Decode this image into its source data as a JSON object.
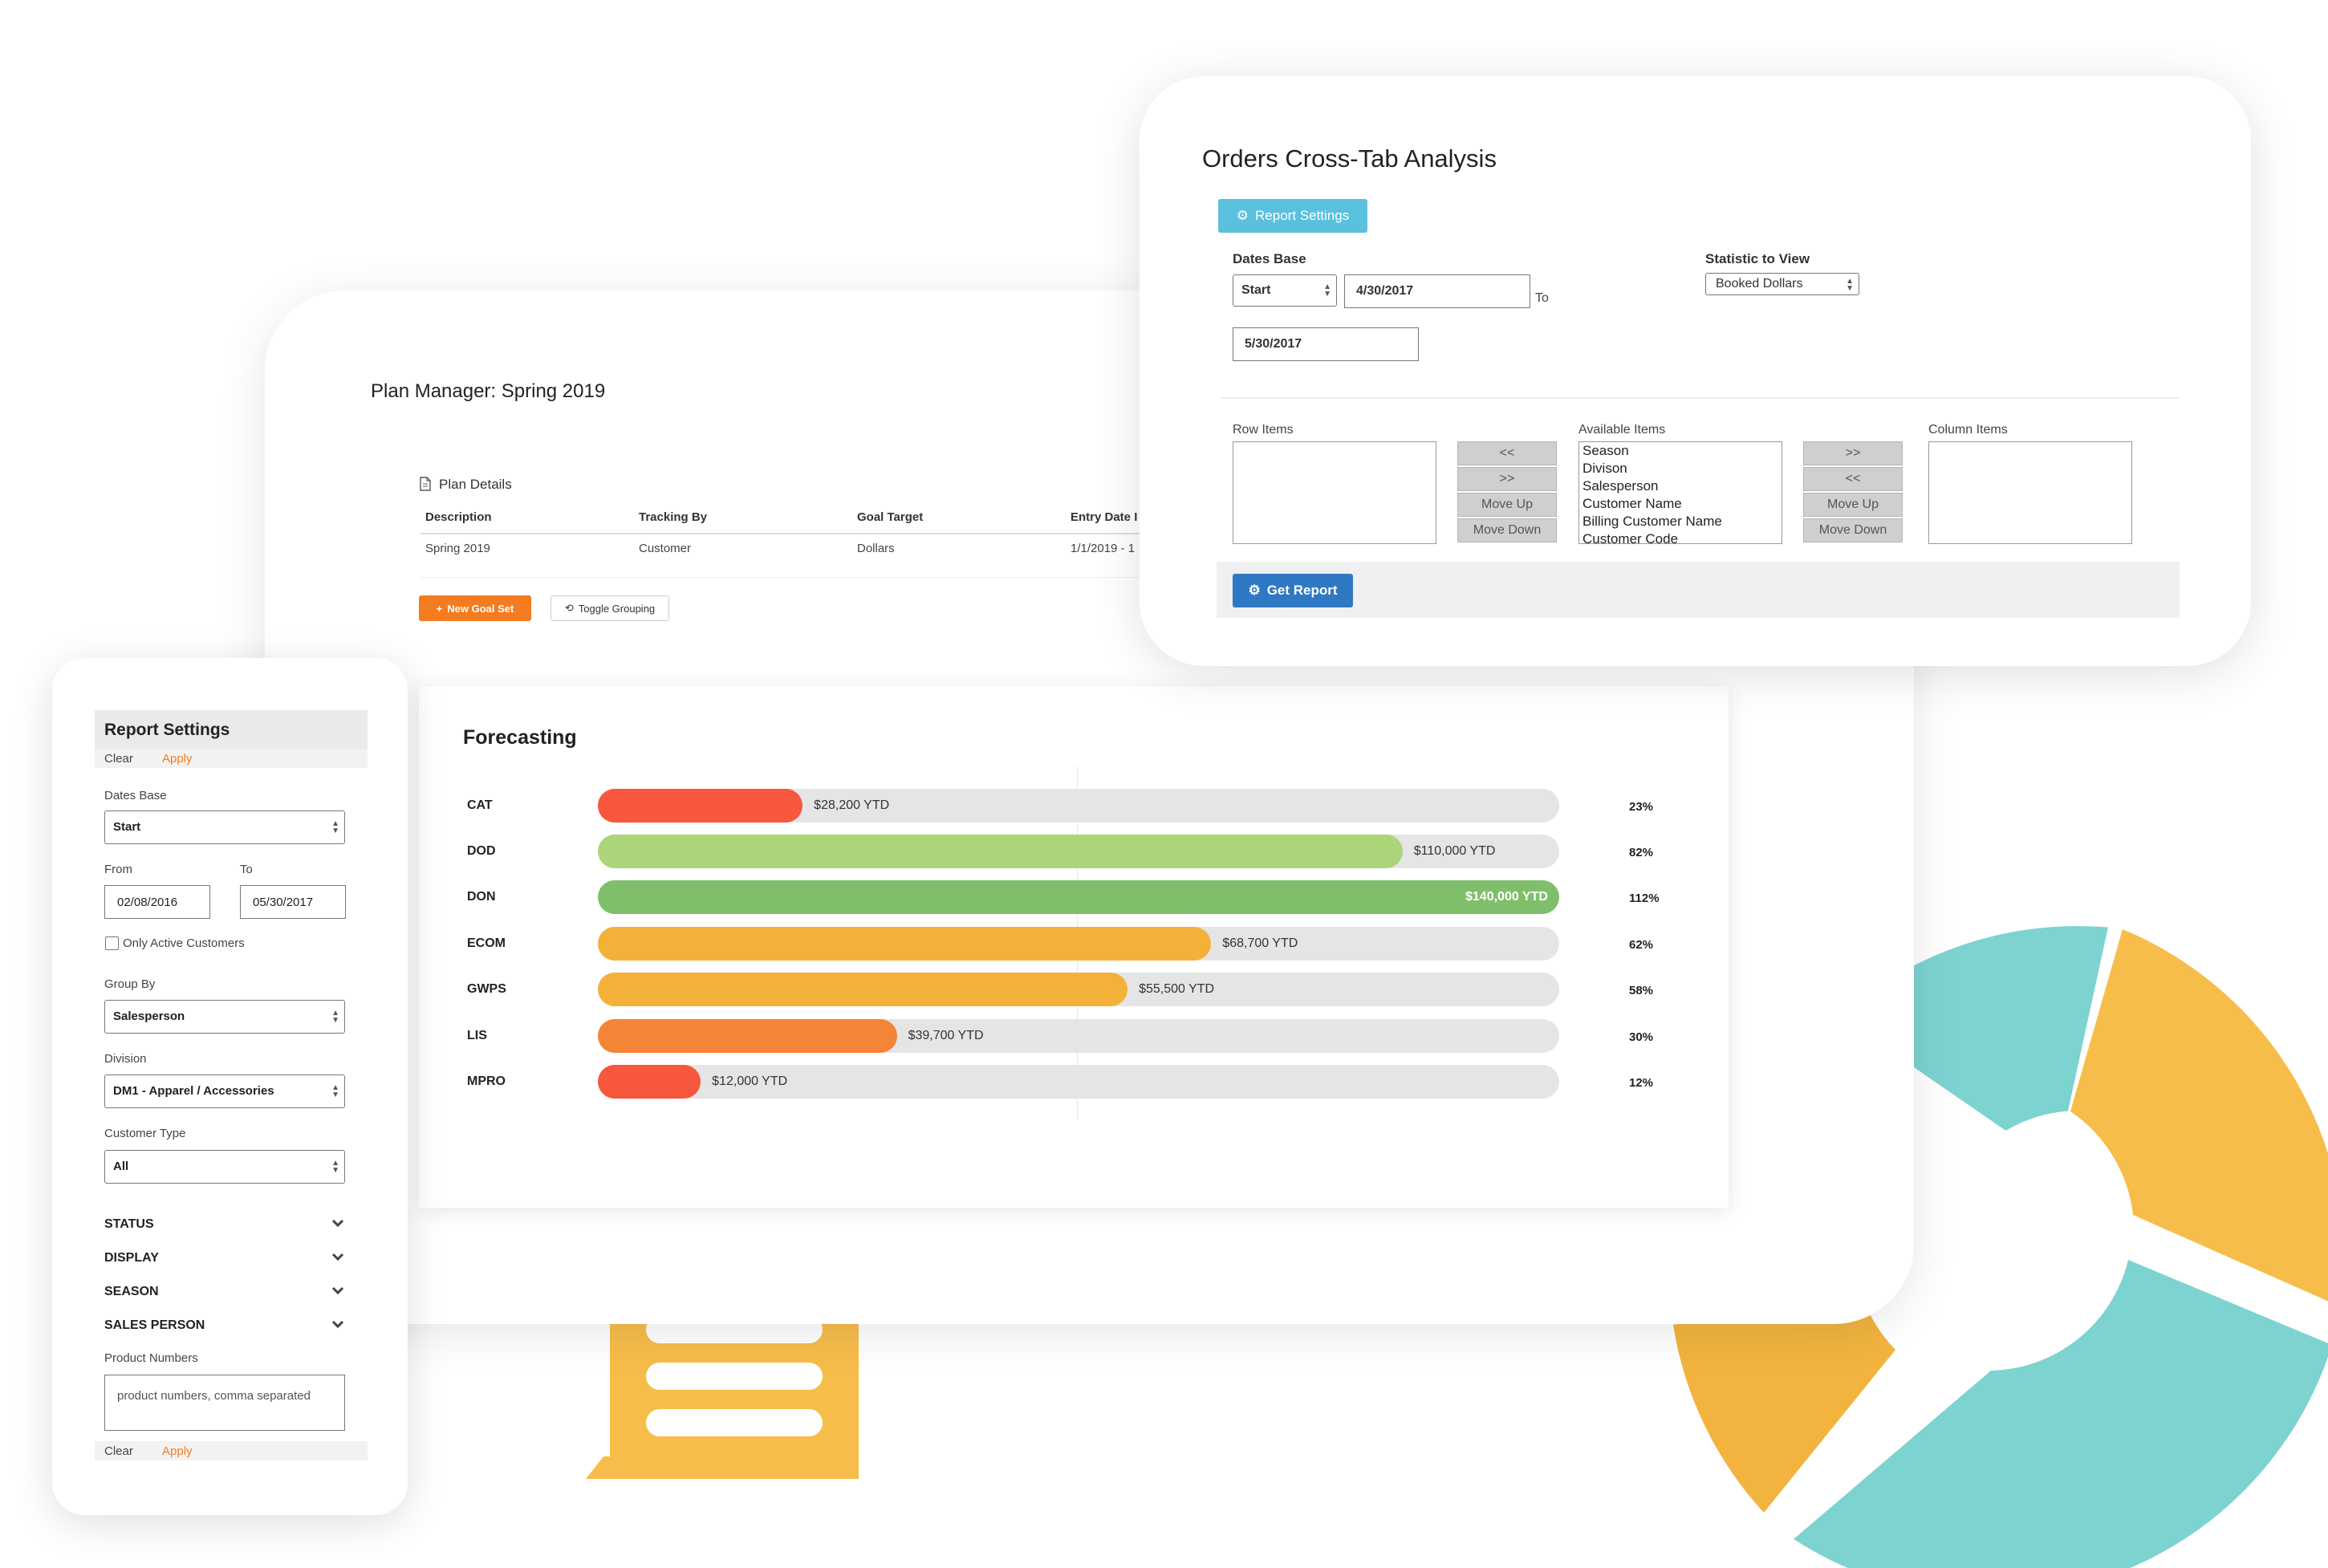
{
  "plan_manager": {
    "title": "Plan Manager: Spring 2019",
    "details_label": "Plan Details",
    "columns": [
      "Description",
      "Tracking By",
      "Goal Target",
      "Entry Date I"
    ],
    "rows": [
      [
        "Spring 2019",
        "Customer",
        "Dollars",
        "1/1/2019 - 1"
      ]
    ],
    "new_goal_label": "New Goal Set",
    "toggle_grouping_label": "Toggle Grouping"
  },
  "forecasting": {
    "title": "Forecasting",
    "rows": [
      {
        "category": "CAT",
        "ytd": "$28,200 YTD",
        "percent": "23%",
        "fill": 0.213,
        "color": "#f6573d"
      },
      {
        "category": "DOD",
        "ytd": "$110,000 YTD",
        "percent": "82%",
        "fill": 0.837,
        "color": "#acd57a"
      },
      {
        "category": "DON",
        "ytd": "$140,000 YTD",
        "percent": "112%",
        "fill": 1.0,
        "color": "#7fbf6b"
      },
      {
        "category": "ECOM",
        "ytd": "$68,700 YTD",
        "percent": "62%",
        "fill": 0.638,
        "color": "#f4b13a"
      },
      {
        "category": "GWPS",
        "ytd": "$55,500 YTD",
        "percent": "58%",
        "fill": 0.551,
        "color": "#f4b13a"
      },
      {
        "category": "LIS",
        "ytd": "$39,700 YTD",
        "percent": "30%",
        "fill": 0.311,
        "color": "#f58536"
      },
      {
        "category": "MPRO",
        "ytd": "$12,000 YTD",
        "percent": "12%",
        "fill": 0.107,
        "color": "#f6573d"
      }
    ]
  },
  "orders_crosstab": {
    "title": "Orders Cross-Tab Analysis",
    "report_settings_label": "Report Settings",
    "dates_base_label": "Dates Base",
    "dates_base_value": "Start",
    "from_date": "4/30/2017",
    "to_label": "To",
    "to_date": "5/30/2017",
    "statistic_label": "Statistic to View",
    "statistic_value": "Booked Dollars",
    "row_items_label": "Row Items",
    "available_items_label": "Available Items",
    "column_items_label": "Column Items",
    "available_items": [
      "Season",
      "Divison",
      "Salesperson",
      "Customer Name",
      "Billing Customer Name",
      "Customer Code"
    ],
    "left_buttons": [
      "<<",
      ">>",
      "Move Up",
      "Move Down"
    ],
    "right_buttons": [
      ">>",
      "<<",
      "Move Up",
      "Move Down"
    ],
    "get_report_label": "Get Report"
  },
  "report_settings": {
    "title": "Report Settings",
    "clear_label": "Clear",
    "apply_label": "Apply",
    "dates_base_label": "Dates Base",
    "dates_base_value": "Start",
    "from_label": "From",
    "to_label": "To",
    "from_date": "02/08/2016",
    "to_date": "05/30/2017",
    "only_active_label": "Only Active Customers",
    "group_by_label": "Group By",
    "group_by_value": "Salesperson",
    "division_label": "Division",
    "division_value": "DM1 - Apparel / Accessories",
    "customer_type_label": "Customer Type",
    "customer_type_value": "All",
    "sections": [
      "STATUS",
      "DISPLAY",
      "SEASON",
      "SALES PERSON"
    ],
    "product_numbers_label": "Product Numbers",
    "product_numbers_placeholder": "product numbers, comma separated"
  },
  "colors": {
    "accent_orange": "#f47b20",
    "info_blue": "#5bc0de",
    "primary_blue": "#2f78c4",
    "donut_teal": "#7dd3d0",
    "donut_yellow": "#f7bd4a"
  },
  "icons": {
    "plan_details": "document-icon",
    "new_goal": "plus-icon",
    "toggle_grouping": "refresh-icon",
    "report_settings": "gear-icon",
    "get_report": "gears-icon",
    "section_toggle": "chevron-down-icon"
  }
}
